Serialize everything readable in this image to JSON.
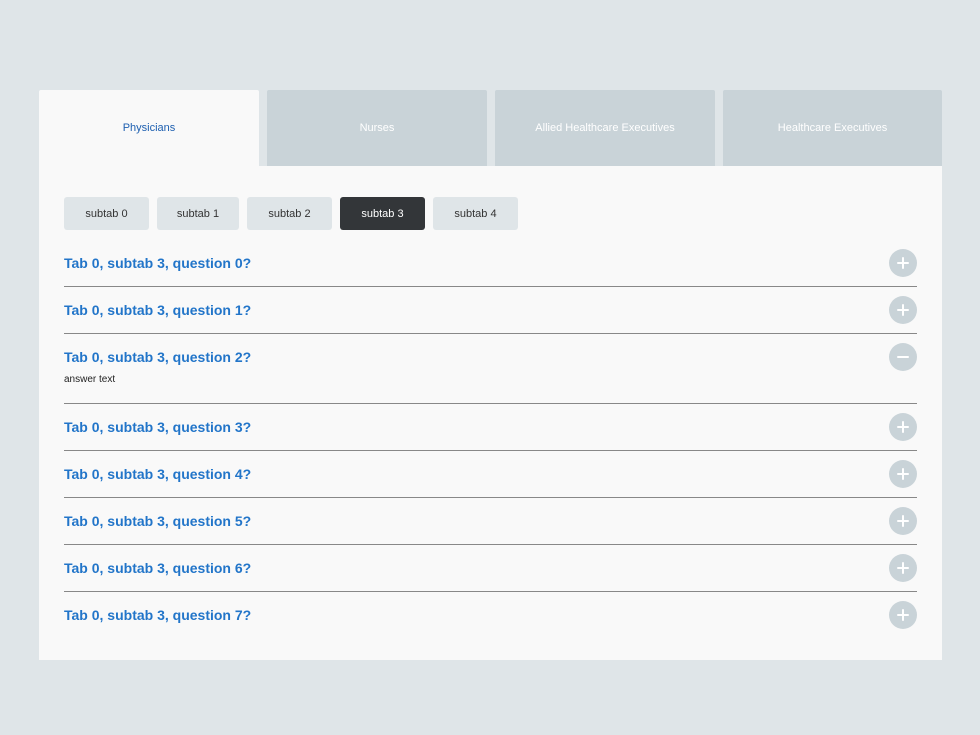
{
  "tabs": [
    {
      "label": "Physicians",
      "active": true
    },
    {
      "label": "Nurses",
      "active": false
    },
    {
      "label": "Allied Healthcare Executives",
      "active": false
    },
    {
      "label": "Healthcare Executives",
      "active": false
    }
  ],
  "subtabs": [
    {
      "label": "subtab 0",
      "active": false
    },
    {
      "label": "subtab 1",
      "active": false
    },
    {
      "label": "subtab 2",
      "active": false
    },
    {
      "label": "subtab 3",
      "active": true
    },
    {
      "label": "subtab 4",
      "active": false
    }
  ],
  "faq": [
    {
      "question": "Tab 0, subtab 3, question 0?",
      "expanded": false
    },
    {
      "question": "Tab 0, subtab 3, question 1?",
      "expanded": false
    },
    {
      "question": "Tab 0, subtab 3, question 2?",
      "expanded": true,
      "answer": "answer text"
    },
    {
      "question": "Tab 0, subtab 3, question 3?",
      "expanded": false
    },
    {
      "question": "Tab 0, subtab 3, question 4?",
      "expanded": false
    },
    {
      "question": "Tab 0, subtab 3, question 5?",
      "expanded": false
    },
    {
      "question": "Tab 0, subtab 3, question 6?",
      "expanded": false
    },
    {
      "question": "Tab 0, subtab 3, question 7?",
      "expanded": false
    }
  ],
  "colors": {
    "background": "#dfe5e8",
    "tab_inactive": "#c9d3d8",
    "tab_active_text": "#1d5fb0",
    "question_text": "#2275c9",
    "subtab_active": "#333639"
  },
  "icons": {
    "collapsed": "plus-icon",
    "expanded": "minus-icon"
  }
}
